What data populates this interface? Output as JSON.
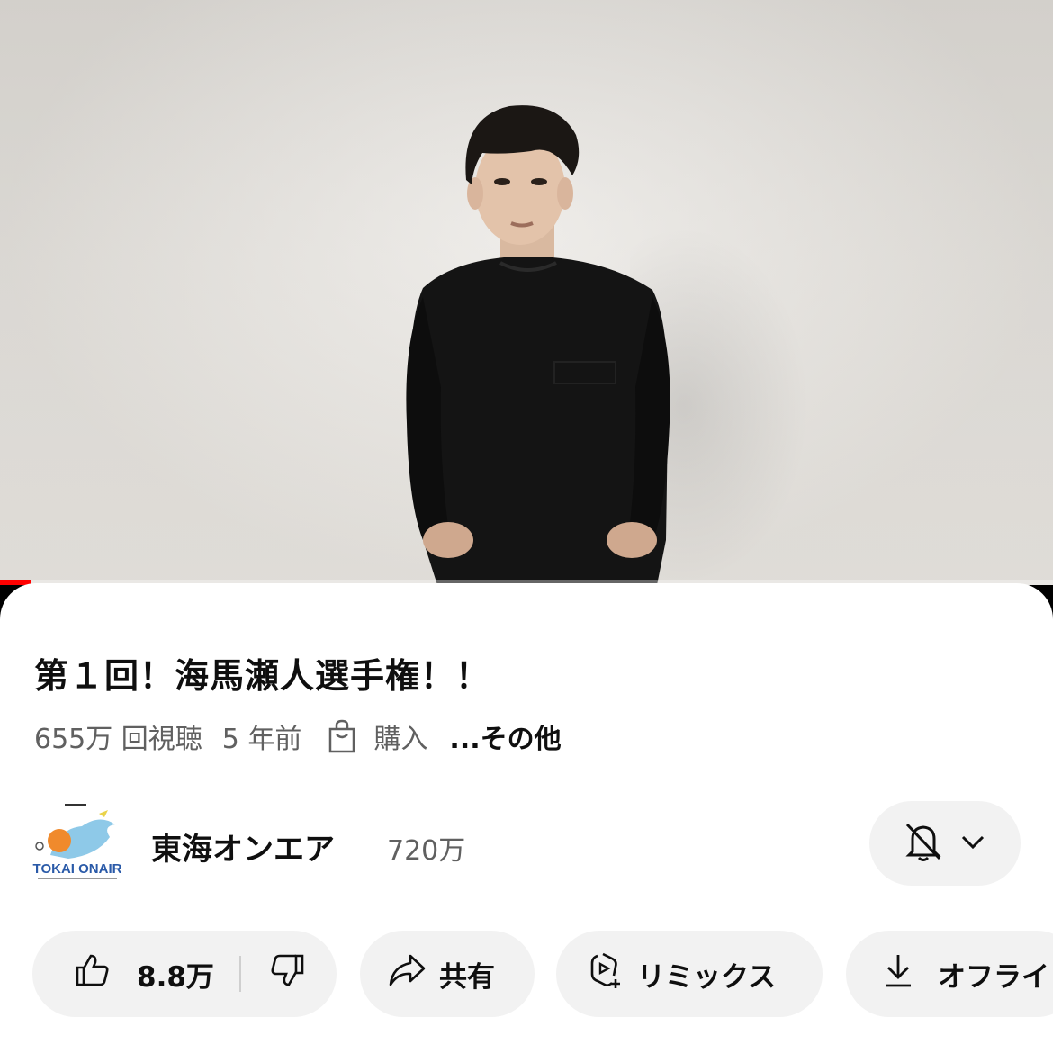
{
  "video": {
    "title": "第１回！海馬瀬人選手権！！",
    "views": "655万 回視聴",
    "age": "5 年前",
    "purchase_label": "購入",
    "more_label": "...その他",
    "progress_fraction": 0.03
  },
  "channel": {
    "name": "東海オンエア",
    "subscribers": "720万",
    "logo_text": "TOKAI ONAIR"
  },
  "actions": {
    "like_count": "8.8万",
    "share_label": "共有",
    "remix_label": "リミックス",
    "download_label": "オフライ"
  },
  "colors": {
    "progress": "#ff0000",
    "pill_bg": "#f2f2f2",
    "secondary_text": "#606060"
  },
  "icons": [
    "bag-icon",
    "bell-off-icon",
    "chevron-down-icon",
    "thumbs-up-icon",
    "thumbs-down-icon",
    "share-arrow-icon",
    "remix-icon",
    "download-icon"
  ]
}
